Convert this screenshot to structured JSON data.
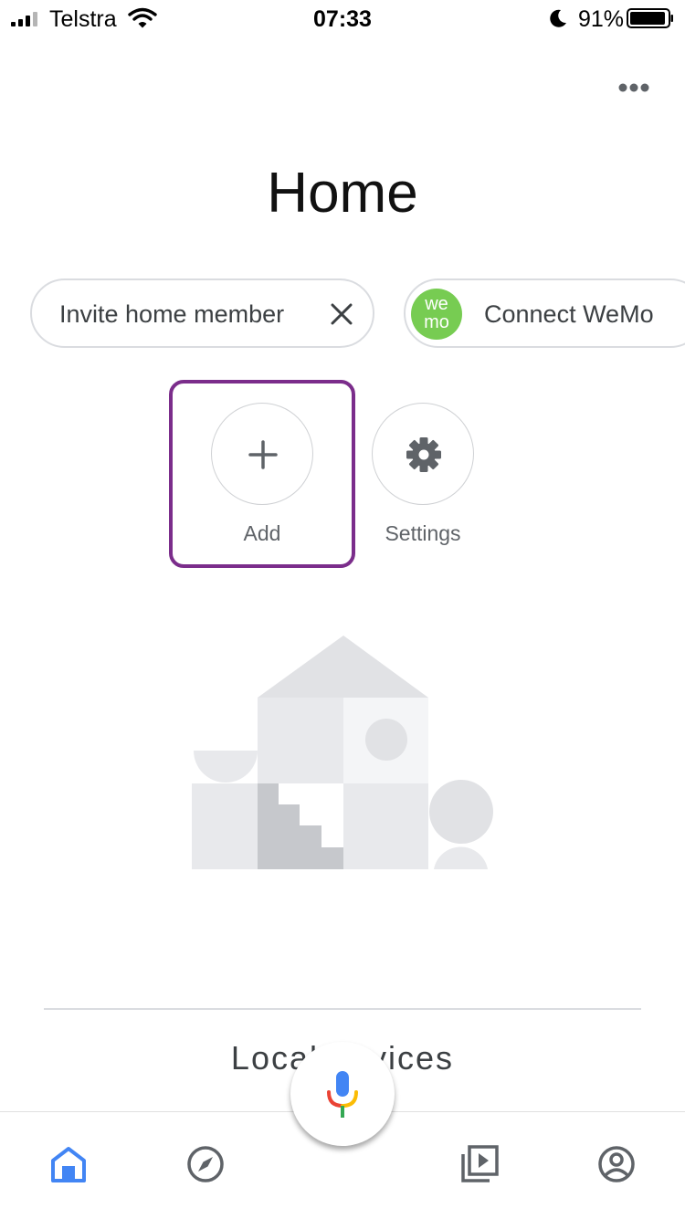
{
  "status_bar": {
    "carrier": "Telstra",
    "time": "07:33",
    "battery_percent": "91%",
    "icons": [
      "signal-icon",
      "wifi-icon",
      "moon-icon",
      "battery-icon"
    ]
  },
  "header": {
    "more_icon": "more-horizontal-icon",
    "title": "Home"
  },
  "chips": [
    {
      "label": "Invite home member",
      "icon": "close-icon"
    },
    {
      "label": "Connect WeMo",
      "logo_text": [
        "we",
        "mo"
      ],
      "logo_color": "#77cc52"
    }
  ],
  "actions": [
    {
      "label": "Add",
      "icon": "plus-icon",
      "highlighted": true
    },
    {
      "label": "Settings",
      "icon": "gear-icon"
    }
  ],
  "highlight_color": "#7b2d8b",
  "section": {
    "heading": "Local devices"
  },
  "bottom_nav": {
    "items": [
      {
        "icon": "home-icon",
        "active": true
      },
      {
        "icon": "compass-icon",
        "active": false
      },
      {
        "icon": "media-icon",
        "active": false
      },
      {
        "icon": "account-icon",
        "active": false
      }
    ],
    "active_color": "#4285f4",
    "mic_icon": "mic-icon"
  }
}
